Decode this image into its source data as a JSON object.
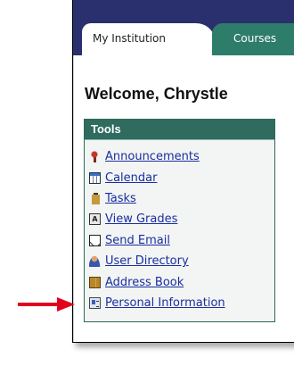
{
  "tabs": [
    {
      "label": "My Institution",
      "active": true
    },
    {
      "label": "Courses",
      "active": false
    }
  ],
  "welcome_text": "Welcome, Chrystle",
  "tools": {
    "title": "Tools",
    "items": [
      {
        "label": "Announcements",
        "icon": "pushpin-icon"
      },
      {
        "label": "Calendar",
        "icon": "calendar-icon"
      },
      {
        "label": "Tasks",
        "icon": "clipboard-icon"
      },
      {
        "label": "View Grades",
        "icon": "grades-icon"
      },
      {
        "label": "Send Email",
        "icon": "envelope-icon"
      },
      {
        "label": "User Directory",
        "icon": "user-icon"
      },
      {
        "label": "Address Book",
        "icon": "book-icon"
      },
      {
        "label": "Personal Information",
        "icon": "id-card-icon"
      }
    ]
  },
  "colors": {
    "header": "#2a2f6d",
    "inactive_tab": "#2e7d6a",
    "tools_header": "#2f6b5e",
    "link": "#1a2ea0",
    "arrow": "#e3001b"
  }
}
